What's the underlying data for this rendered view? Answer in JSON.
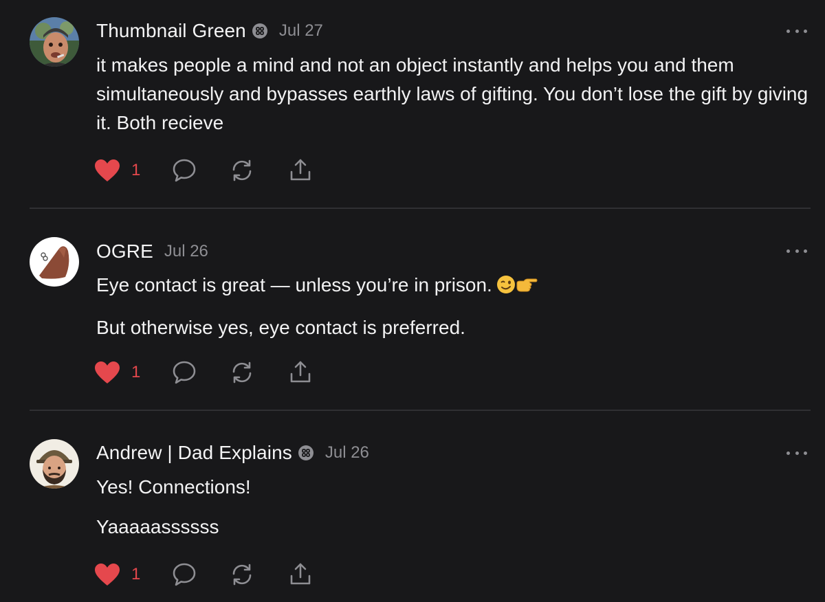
{
  "comments": [
    {
      "author": "Thumbnail Green",
      "date": "Jul 27",
      "has_badge": true,
      "paragraphs": [
        "it makes people a mind and not an object instantly and helps you and them simultaneously and bypasses earthly laws of gifting. You don’t lose the gift by giving it. Both recieve"
      ],
      "likes": "1"
    },
    {
      "author": "OGRE",
      "date": "Jul 26",
      "has_badge": false,
      "paragraphs": [
        "Eye contact is great — unless you’re in prison.",
        "But otherwise yes, eye contact is preferred."
      ],
      "likes": "1"
    },
    {
      "author": "Andrew | Dad Explains",
      "date": "Jul 26",
      "has_badge": true,
      "paragraphs": [
        "Yes! Connections!",
        "Yaaaaassssss"
      ],
      "likes": "1"
    }
  ],
  "icons": {
    "like": "heart-icon",
    "reply": "comment-bubble-icon",
    "restack": "restack-icon",
    "share": "share-icon",
    "more": "more-options-icon",
    "badge": "subscriber-badge-icon"
  },
  "colors": {
    "background": "#18181a",
    "text": "#f2f2f3",
    "muted": "#8e8e93",
    "like": "#e5484d",
    "divider": "#303033"
  }
}
